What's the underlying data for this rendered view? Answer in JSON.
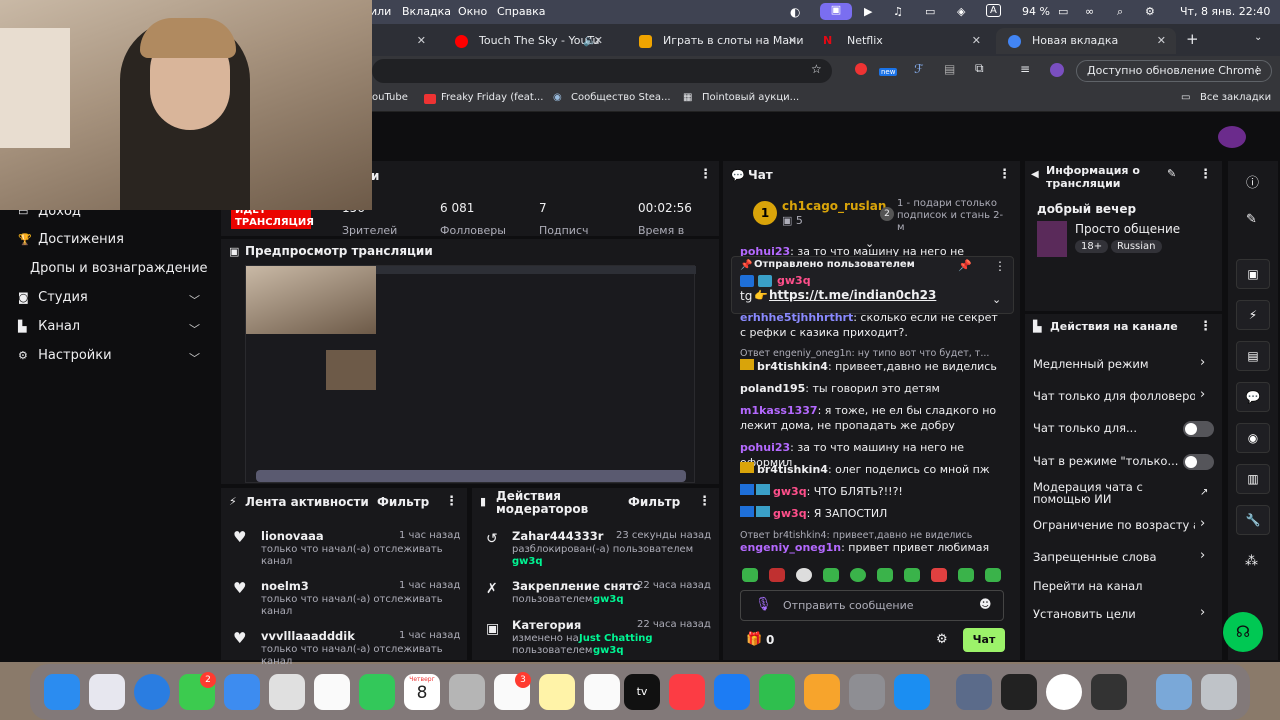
{
  "menubar": {
    "items": [
      "или",
      "Вкладка",
      "Окно",
      "Справка"
    ],
    "battery": "94 %",
    "lang": "A",
    "datetime": "Чт, 8 янв.  22:40"
  },
  "tabs": [
    {
      "label": "Touch The Sky - YouTu",
      "color": "#ff0000"
    },
    {
      "label": "Играть в слоты на Мани",
      "color": "#f0a400"
    },
    {
      "label": "Netflix",
      "color": "#e50914"
    },
    {
      "label": "Новая вкладка",
      "color": "#4285f4"
    }
  ],
  "browser": {
    "update_label": "Доступно обновление Chrome",
    "new_badge": "new"
  },
  "bookmarks": [
    "YouTube",
    "Freaky Friday (feat....",
    "Сообщество Stea...",
    "Пointowый аукци...",
    "Все закладки"
  ],
  "bookmarks_fixed": [
    "ouTube",
    "Freaky Friday (feat...",
    "Сообщество Stea...",
    "Пointовый аукци...",
    "Все закладки"
  ],
  "left_nav": {
    "items": [
      {
        "label": "Доход",
        "icon": "money-icon"
      },
      {
        "label": "Достижения",
        "icon": "trophy-icon"
      },
      {
        "label": "Дропы и вознаграждение",
        "icon": ""
      },
      {
        "label": "Студия",
        "icon": "camera-icon"
      },
      {
        "label": "Канал",
        "icon": "channel-icon"
      },
      {
        "label": "Настройки",
        "icon": "gear-icon"
      }
    ]
  },
  "stats": {
    "header": "и",
    "live_badge": "ИДЕТ ТРАНСЛЯЦИЯ",
    "viewers": "156",
    "viewers_label": "Зрителей",
    "followers": "6 081",
    "followers_label": "Фолловеры",
    "subs": "7",
    "subs_label": "Подписч",
    "time": "00:02:56",
    "time_label": "Время в"
  },
  "preview": {
    "title": "Предпросмотр трансляции"
  },
  "activity": {
    "title": "Лента активности",
    "filter": "Фильтр",
    "items": [
      {
        "name": "lionovaaa",
        "text": "только что начал(-а) отслеживать канал",
        "time": "1 час назад"
      },
      {
        "name": "noelm3",
        "text": "только что начал(-а) отслеживать канал",
        "time": "1 час назад"
      },
      {
        "name": "vvvlllaaadddik",
        "text": "только что начал(-а) отслеживать канал",
        "time": "1 час назад"
      }
    ]
  },
  "mod": {
    "title": "Действия модераторов",
    "filter": "Фильтр",
    "items": [
      {
        "name": "Zahar444333r",
        "time": "23 секунды назад",
        "text": "разблокирован(-а) пользователем",
        "user": "gw3q"
      },
      {
        "name": "Закрепление снято",
        "time": "22 часа назад",
        "text": "пользователем",
        "user": "gw3q"
      },
      {
        "name": "Категория",
        "time": "22 часа назад",
        "text": "изменено на",
        "user": "Just Chatting",
        "text2": "пользователем",
        "user2": "gw3q"
      }
    ]
  },
  "chat": {
    "title": "Чат",
    "top_user": "ch1cago_ruslan",
    "top_count": "5",
    "top_gift": "1 - подари столько подписок и стань 2-м",
    "pinned_label": "Отправлено пользователем",
    "pinned_user": "gw3q",
    "pinned_prefix": "tg",
    "pinned_link": "https://t.me/indian0ch23",
    "messages": [
      {
        "user": "pohui23",
        "color": "#b469ff",
        "text": ": за то что машину на него не оформил"
      },
      {
        "user": "erhhhe5tjhhhrthrt",
        "color": "#8a8aff",
        "text": ": сколько если не секрет с рефки с казика приходит?."
      },
      {
        "reply": "Ответ engeniy_oneg1n: ну типо вот что будет, т..."
      },
      {
        "user": "br4tishkin4",
        "color": "#efeff1",
        "text": ": привеет,давно не виделись"
      },
      {
        "user": "poland195",
        "color": "#efeff1",
        "text": ": ты говорил это детям"
      },
      {
        "user": "m1kass1337",
        "color": "#b469ff",
        "text": ": я тоже, не ел бы сладкого но лежит дома, не пропадать же добру"
      },
      {
        "user": "pohui23",
        "color": "#b469ff",
        "text": ": за то что машину на него не оформил"
      },
      {
        "user": "br4tishkin4",
        "color": "#efeff1",
        "text": ": олег поделись со мной пж"
      },
      {
        "user": "gw3q",
        "color": "#ff4f8b",
        "text": ": ЧТО БЛЯТЬ?!!?!"
      },
      {
        "user": "gw3q",
        "color": "#ff4f8b",
        "text": ": Я ЗАПОСТИЛ"
      },
      {
        "reply": "Ответ br4tishkin4: привеет,давно не виделись"
      },
      {
        "user": "engeniy_oneg1n",
        "color": "#b469ff",
        "text": ": привет привет любимая"
      }
    ],
    "input_placeholder": "Отправить сообщение",
    "points": "0",
    "send": "Чат"
  },
  "info": {
    "title": "Информация о трансляции",
    "stream_title": "добрый вечер",
    "category": "Просто общение",
    "tags": [
      "18+",
      "Russian"
    ]
  },
  "channel_actions": {
    "title": "Действия на канале",
    "items": [
      {
        "label": "Медленный режим",
        "type": "arrow"
      },
      {
        "label": "Чат только для фолловеров",
        "type": "arrow"
      },
      {
        "label": "Чат только для...",
        "type": "toggle"
      },
      {
        "label": "Чат в режиме \"только...",
        "type": "toggle"
      },
      {
        "label": "Модерация чата с помощью ИИ",
        "type": "ext"
      },
      {
        "label": "Ограничение по возрасту а",
        "type": "arrow"
      },
      {
        "label": "Запрещенные слова",
        "type": "arrow"
      },
      {
        "label": "Перейти на канал",
        "type": "none"
      },
      {
        "label": "Установить цели",
        "type": "arrow"
      }
    ]
  },
  "dock": {
    "calendar_month": "Четверг",
    "calendar_day": "8",
    "badge_messages": "2",
    "badge_reminders": "3",
    "tv_label": "tv"
  },
  "colors": {
    "accent": "#bf94ff",
    "live": "#eb0400",
    "green": "#00f593",
    "bg": "#0e0e10",
    "panel": "#18181b"
  }
}
